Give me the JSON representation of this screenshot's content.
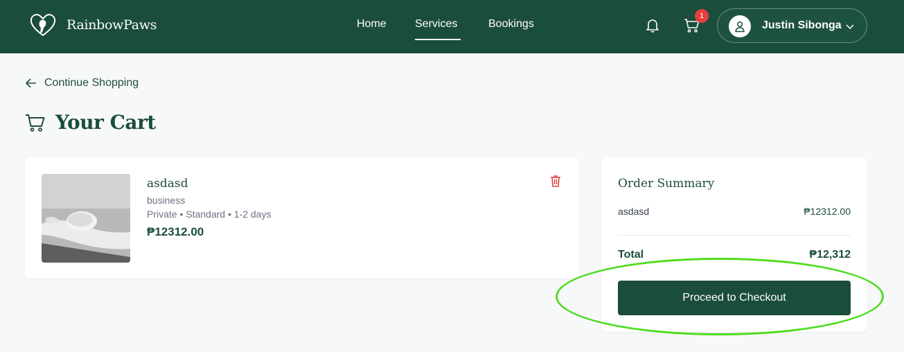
{
  "brand": {
    "name": "RainbowPaws",
    "logo_icon": "paw-heart-logo-icon"
  },
  "nav": {
    "home": "Home",
    "services": "Services",
    "bookings": "Bookings",
    "active": "Services"
  },
  "header": {
    "notification_icon": "bell-icon",
    "cart_icon": "cart-icon",
    "cart_count": "1",
    "user_name": "Justin Sibonga"
  },
  "back_link": "Continue Shopping",
  "page_title": "Your Cart",
  "cart_item": {
    "name": "asdasd",
    "category": "business",
    "meta": "Private • Standard • 1-2 days",
    "price": "₱12312.00"
  },
  "summary": {
    "title": "Order Summary",
    "line_name": "asdasd",
    "line_price": "₱12312.00",
    "total_label": "Total",
    "total_value": "₱12,312",
    "checkout_label": "Proceed to Checkout"
  },
  "colors": {
    "primary": "#1b4d3b",
    "badge": "#e53e3e",
    "delete": "#e53e3e",
    "highlight": "#4cdd1a"
  }
}
